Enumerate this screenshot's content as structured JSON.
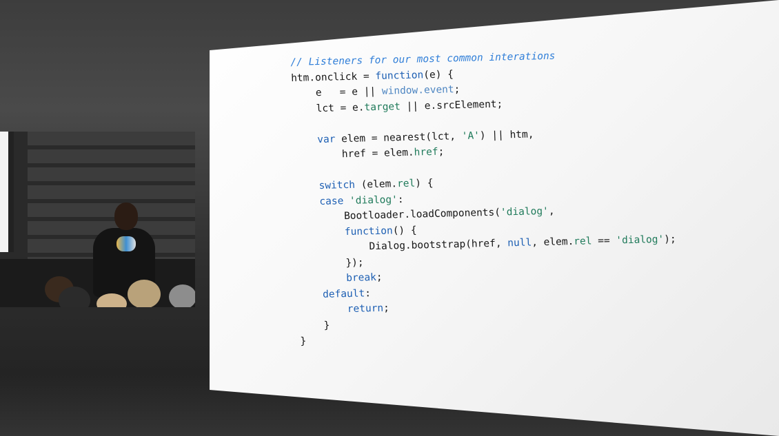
{
  "slide": {
    "code_lines": [
      [
        {
          "t": "// Listeners for our most common interations",
          "c": "comment"
        }
      ],
      [
        {
          "t": "htm",
          "c": "plain"
        },
        {
          "t": ".",
          "c": "plain"
        },
        {
          "t": "onclick",
          "c": "plain"
        },
        {
          "t": " = ",
          "c": "plain"
        },
        {
          "t": "function",
          "c": "kw"
        },
        {
          "t": "(e) {",
          "c": "plain"
        }
      ],
      [
        {
          "t": "    e   = e || ",
          "c": "plain"
        },
        {
          "t": "window.event",
          "c": "muted"
        },
        {
          "t": ";",
          "c": "plain"
        }
      ],
      [
        {
          "t": "    lct = e.",
          "c": "plain"
        },
        {
          "t": "target",
          "c": "prop"
        },
        {
          "t": " || e.srcElement;",
          "c": "plain"
        }
      ],
      [
        {
          "t": "",
          "c": "plain"
        }
      ],
      [
        {
          "t": "    ",
          "c": "plain"
        },
        {
          "t": "var",
          "c": "kw"
        },
        {
          "t": " elem = nearest(lct, ",
          "c": "plain"
        },
        {
          "t": "'A'",
          "c": "string"
        },
        {
          "t": ") || htm,",
          "c": "plain"
        }
      ],
      [
        {
          "t": "        href = elem.",
          "c": "plain"
        },
        {
          "t": "href",
          "c": "prop"
        },
        {
          "t": ";",
          "c": "plain"
        }
      ],
      [
        {
          "t": "",
          "c": "plain"
        }
      ],
      [
        {
          "t": "    ",
          "c": "plain"
        },
        {
          "t": "switch",
          "c": "kw"
        },
        {
          "t": " (elem.",
          "c": "plain"
        },
        {
          "t": "rel",
          "c": "prop"
        },
        {
          "t": ") {",
          "c": "plain"
        }
      ],
      [
        {
          "t": "    ",
          "c": "plain"
        },
        {
          "t": "case",
          "c": "kw"
        },
        {
          "t": " ",
          "c": "plain"
        },
        {
          "t": "'dialog'",
          "c": "string"
        },
        {
          "t": ":",
          "c": "plain"
        }
      ],
      [
        {
          "t": "        Bootloader.loadComponents(",
          "c": "plain"
        },
        {
          "t": "'dialog'",
          "c": "string"
        },
        {
          "t": ",",
          "c": "plain"
        }
      ],
      [
        {
          "t": "        ",
          "c": "plain"
        },
        {
          "t": "function",
          "c": "kw"
        },
        {
          "t": "() {",
          "c": "plain"
        }
      ],
      [
        {
          "t": "            Dialog.bootstrap(href, ",
          "c": "plain"
        },
        {
          "t": "null",
          "c": "kw"
        },
        {
          "t": ", elem.",
          "c": "plain"
        },
        {
          "t": "rel",
          "c": "prop"
        },
        {
          "t": " == ",
          "c": "plain"
        },
        {
          "t": "'dialog'",
          "c": "string"
        },
        {
          "t": ");",
          "c": "plain"
        }
      ],
      [
        {
          "t": "        });",
          "c": "plain"
        }
      ],
      [
        {
          "t": "        ",
          "c": "plain"
        },
        {
          "t": "break",
          "c": "kw"
        },
        {
          "t": ";",
          "c": "plain"
        }
      ],
      [
        {
          "t": "    ",
          "c": "plain"
        },
        {
          "t": "default",
          "c": "kw"
        },
        {
          "t": ":",
          "c": "plain"
        }
      ],
      [
        {
          "t": "        ",
          "c": "plain"
        },
        {
          "t": "return",
          "c": "kw"
        },
        {
          "t": ";",
          "c": "plain"
        }
      ],
      [
        {
          "t": "    }",
          "c": "plain"
        }
      ],
      [
        {
          "t": "}",
          "c": "plain"
        }
      ]
    ]
  },
  "video": {
    "speaker_shirt_logo": "colorful-logo"
  },
  "colors": {
    "comment": "#2f7ed8",
    "keyword": "#1d5fb3",
    "property": "#1f7a5a",
    "string": "#1f7a5a"
  }
}
